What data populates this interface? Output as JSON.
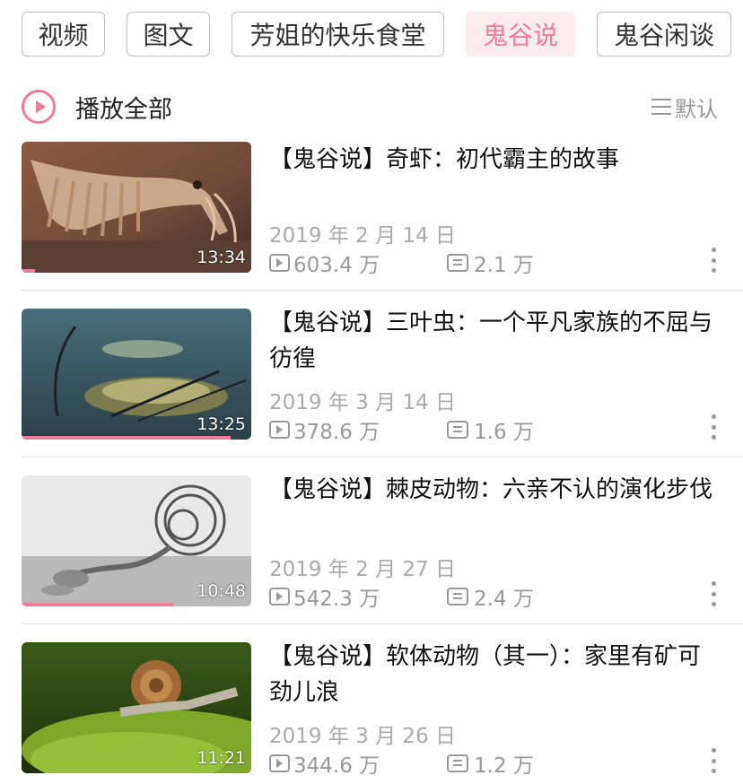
{
  "tabs": [
    {
      "label": "视频"
    },
    {
      "label": "图文"
    },
    {
      "label": "芳姐的快乐食堂"
    },
    {
      "label": "鬼谷说"
    },
    {
      "label": "鬼谷闲谈"
    }
  ],
  "active_tab": "鬼谷说",
  "play_all_label": "播放全部",
  "sort_label": "默认",
  "accent_color": "#ef7c98",
  "videos": [
    {
      "title": "【鬼谷说】奇虾：初代霸主的故事",
      "date": "2019 年 2 月 14 日",
      "views": "603.4 万",
      "comments": "2.1 万",
      "duration": "13:34",
      "watch_progress": 0.06,
      "thumbnail_icon": "anomalocaris-image"
    },
    {
      "title": "【鬼谷说】三叶虫：一个平凡家族的不屈与彷徨",
      "date": "2019 年 3 月 14 日",
      "views": "378.6 万",
      "comments": "1.6 万",
      "duration": "13:25",
      "watch_progress": 0.91,
      "thumbnail_icon": "trilobite-image"
    },
    {
      "title": "【鬼谷说】棘皮动物：六亲不认的演化步伐",
      "date": "2019 年 2 月 27 日",
      "views": "542.3 万",
      "comments": "2.4 万",
      "duration": "10:48",
      "watch_progress": 0.66,
      "thumbnail_icon": "echinoderm-image"
    },
    {
      "title": "【鬼谷说】软体动物（其一）：家里有矿可劲儿浪",
      "date": "2019 年 3 月 26 日",
      "views": "344.6 万",
      "comments": "1.2 万",
      "duration": "11:21",
      "watch_progress": 0,
      "thumbnail_icon": "snail-image"
    }
  ]
}
